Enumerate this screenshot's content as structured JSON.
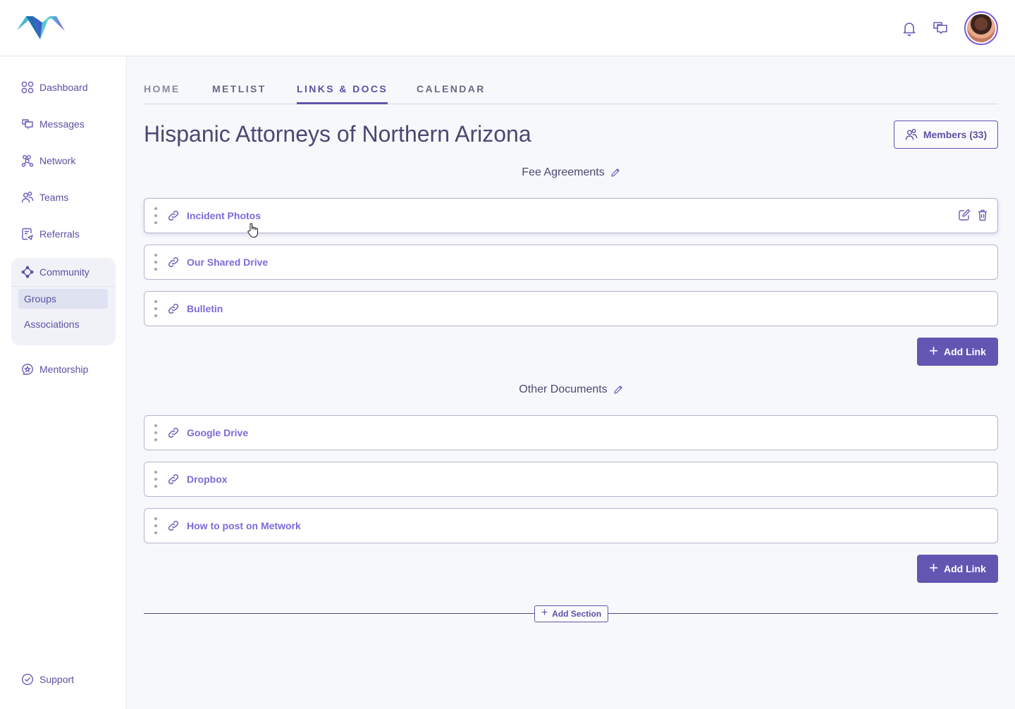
{
  "header": {
    "logo": "metwork-logo",
    "icons": [
      "bell-icon",
      "messages-icon"
    ],
    "avatar_alt": "user-avatar"
  },
  "sidebar": {
    "items": [
      {
        "label": "Dashboard",
        "icon": "grid-icon"
      },
      {
        "label": "Messages",
        "icon": "messages-icon"
      },
      {
        "label": "Network",
        "icon": "network-icon"
      },
      {
        "label": "Teams",
        "icon": "team-icon"
      },
      {
        "label": "Referrals",
        "icon": "referral-icon"
      }
    ],
    "community": {
      "label": "Community",
      "icon": "community-icon",
      "sub_items": [
        {
          "label": "Groups",
          "active": true
        },
        {
          "label": "Associations",
          "active": false
        }
      ]
    },
    "mentorship": {
      "label": "Mentorship",
      "icon": "mentorship-icon"
    },
    "support": {
      "label": "Support",
      "icon": "support-icon"
    }
  },
  "tabs": [
    {
      "label": "HOME",
      "active": false
    },
    {
      "label": "METLIST",
      "active": false
    },
    {
      "label": "LINKS & DOCS",
      "active": true
    },
    {
      "label": "CALENDAR",
      "active": false
    }
  ],
  "page": {
    "title": "Hispanic Attorneys of Northern Arizona",
    "members_label": "Members (33)"
  },
  "sections": [
    {
      "title": "Fee Agreements",
      "links": [
        "Incident Photos",
        "Our Shared Drive",
        "Bulletin"
      ],
      "add_label": "Add Link"
    },
    {
      "title": "Other Documents",
      "links": [
        "Google Drive",
        "Dropbox",
        "How to post on Metwork"
      ],
      "add_label": "Add Link"
    }
  ],
  "add_section_label": "Add Section",
  "colors": {
    "accent": "#6157b3",
    "link_text": "#7e6ad8",
    "text": "#4a4872"
  }
}
